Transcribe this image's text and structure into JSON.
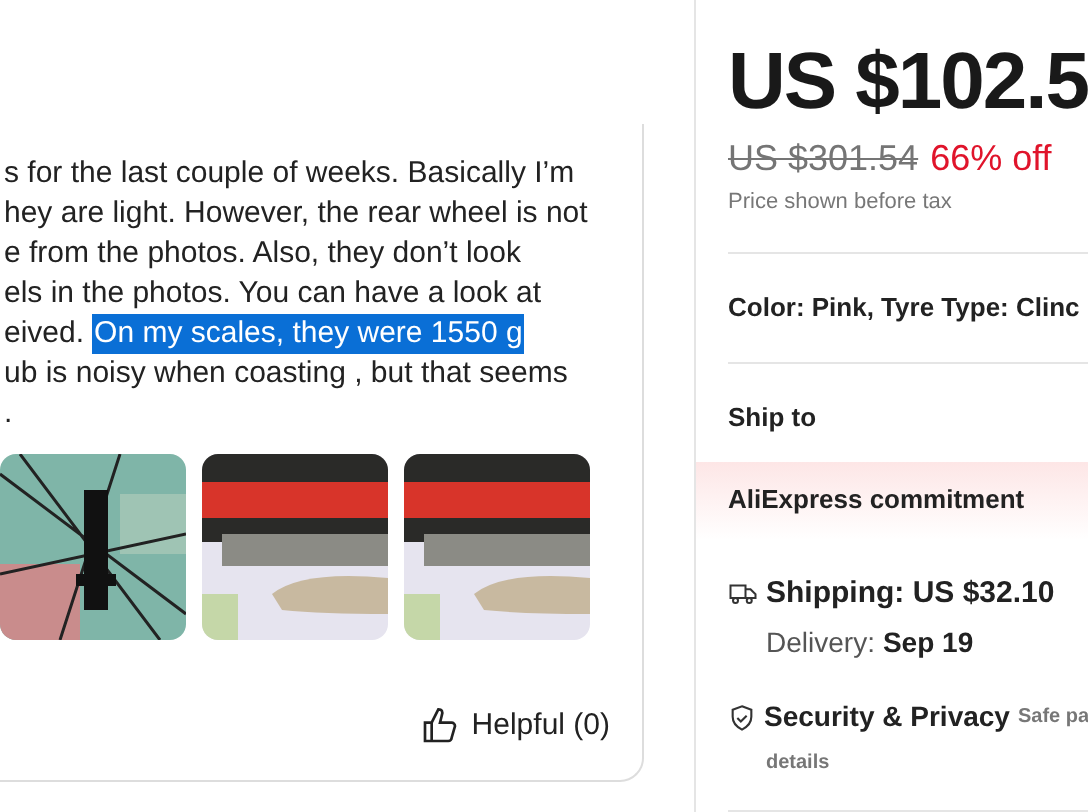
{
  "review": {
    "lines": [
      {
        "text": "s for the last couple of weeks. Basically I’m"
      },
      {
        "text": "hey are light. However, the rear wheel is not"
      },
      {
        "text": "e from the photos. Also, they don’t look"
      },
      {
        "text": "els in the photos. You can have a look at"
      },
      {
        "text": "eived.",
        "highlight": "On my scales, they were 1550 g"
      },
      {
        "text": "ub is noisy when coasting , but that seems"
      },
      {
        "text": "."
      }
    ],
    "helpful": "Helpful (0)"
  },
  "product": {
    "price": "US $102.5",
    "original_price": "US $301.54",
    "discount": "66% off",
    "tax_note": "Price shown before tax",
    "variant": "Color: Pink, Tyre Type: Clinc",
    "ship_to": "Ship to",
    "commitment": "AliExpress commitment",
    "shipping": "Shipping: US $32.10",
    "delivery_label": "Delivery:",
    "delivery_date": "Sep 19",
    "security": "Security & Privacy",
    "security_note": "Safe pa",
    "security_more": "details"
  }
}
